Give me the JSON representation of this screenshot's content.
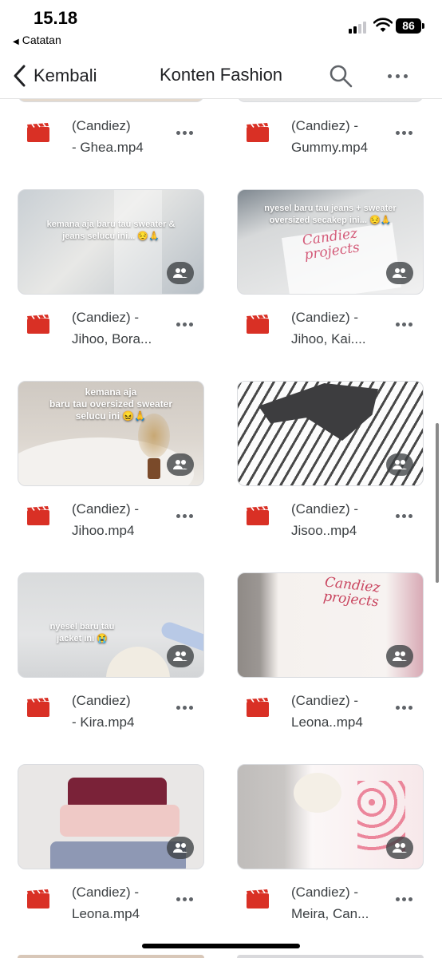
{
  "status_bar": {
    "time": "15.18",
    "back_app": "Catatan",
    "battery": "86"
  },
  "header": {
    "back_label": "Kembali",
    "title": "Konten Fashion"
  },
  "files": [
    {
      "name": "(Candiez)\n- Ghea.mp4",
      "caption": ""
    },
    {
      "name": "(Candiez) -\nGummy.mp4",
      "caption": ""
    },
    {
      "name": "(Candiez) -\nJihoo, Bora...",
      "caption": "kemana aja baru tau sweater &\njeans selucu ini... 😔🙏"
    },
    {
      "name": "(Candiez) -\nJihoo, Kai....",
      "caption": "nyesel baru tau jeans + sweater\noversized secakep ini... 😔🙏",
      "logo": "Candiez\nprojects"
    },
    {
      "name": "(Candiez) -\nJihoo.mp4",
      "caption": "kemana aja\nbaru tau oversized sweater\nselucu ini 😖🙏"
    },
    {
      "name": "(Candiez) -\nJisoo..mp4",
      "caption": ""
    },
    {
      "name": "(Candiez)\n- Kira.mp4",
      "caption": "nyesel baru tau\njacket ini 😭"
    },
    {
      "name": "(Candiez) -\nLeona..mp4",
      "caption": "",
      "logo": "Candiez\nprojects"
    },
    {
      "name": "(Candiez) -\nLeona.mp4",
      "caption": ""
    },
    {
      "name": "(Candiez) -\nMeira, Can...",
      "caption": ""
    }
  ],
  "colors": {
    "video_icon": "#d93025",
    "shared_badge": "#3c4043",
    "text": "#3c4043"
  },
  "icons": {
    "file": "video-file-icon",
    "shared": "shared-people-icon",
    "more": "more-horizontal-icon",
    "search": "search-icon",
    "back": "chevron-left-icon"
  }
}
